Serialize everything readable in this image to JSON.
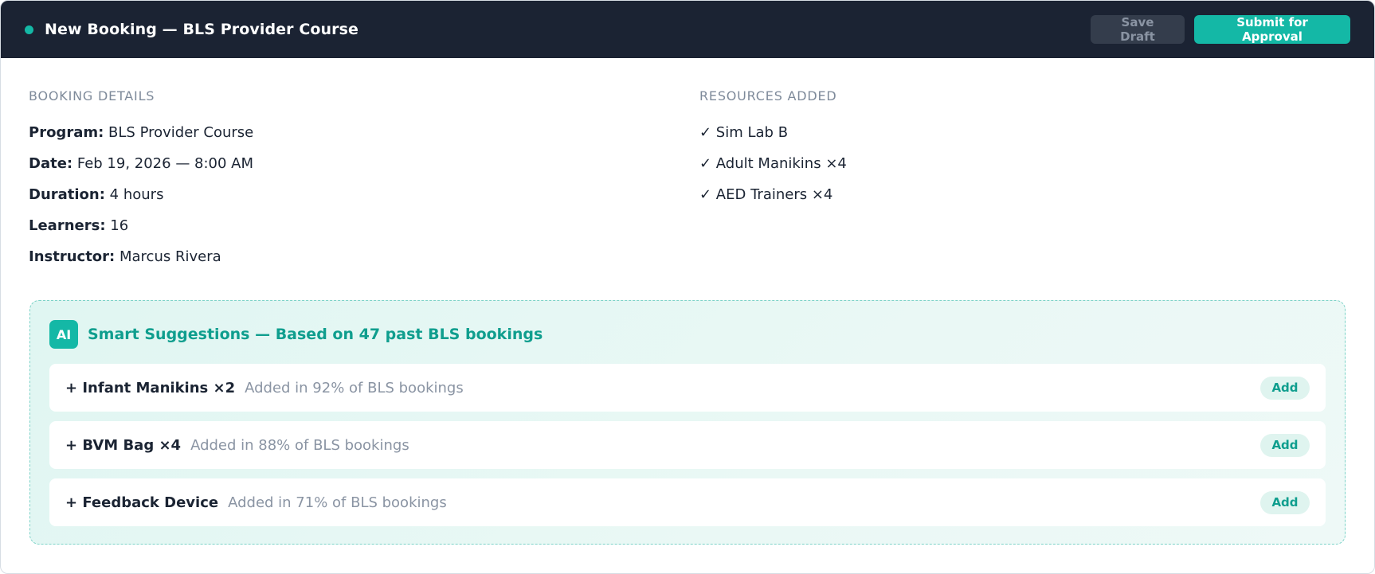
{
  "header": {
    "title": "New Booking — BLS Provider Course",
    "save_draft_label": "Save Draft",
    "submit_label": "Submit for Approval"
  },
  "booking_details": {
    "heading": "BOOKING DETAILS",
    "rows": [
      {
        "key": "Program:",
        "value": "BLS Provider Course"
      },
      {
        "key": "Date:",
        "value": "Feb 19, 2026 — 8:00 AM"
      },
      {
        "key": "Duration:",
        "value": "4 hours"
      },
      {
        "key": "Learners:",
        "value": "16"
      },
      {
        "key": "Instructor:",
        "value": "Marcus Rivera"
      }
    ]
  },
  "resources": {
    "heading": "RESOURCES ADDED",
    "items": [
      "✓ Sim Lab B",
      "✓ Adult Manikins ×4",
      "✓ AED Trainers ×4"
    ]
  },
  "suggestions": {
    "badge": "AI",
    "title": "Smart Suggestions — Based on 47 past BLS bookings",
    "items": [
      {
        "name": "+ Infant Manikins ×2",
        "note": "Added in 92% of BLS bookings",
        "action": "Add"
      },
      {
        "name": "+ BVM Bag ×4",
        "note": "Added in 88% of BLS bookings",
        "action": "Add"
      },
      {
        "name": "+ Feedback Device",
        "note": "Added in 71% of BLS bookings",
        "action": "Add"
      }
    ]
  },
  "colors": {
    "header_bg": "#1b2333",
    "accent": "#14b8a6",
    "accent_text": "#0f9e8e"
  }
}
